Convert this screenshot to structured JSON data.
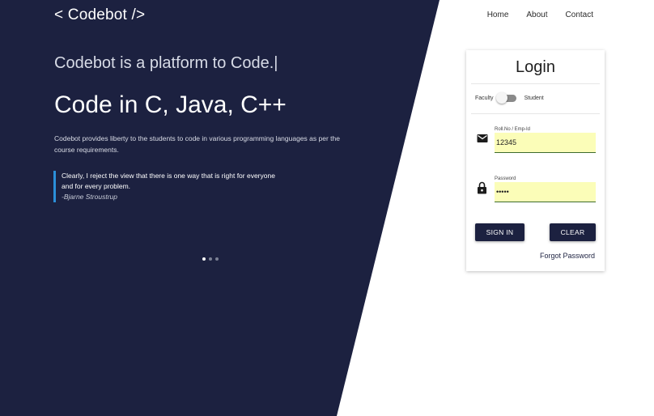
{
  "brand": "< Codebot />",
  "nav": {
    "home": "Home",
    "about": "About",
    "contact": "Contact"
  },
  "hero": {
    "typed_text": "Codebot is a platform to Code.|",
    "headline": "Code in C, Java, C++",
    "description": "Codebot provides liberty to the students to code in various programming languages as per the course requirements.",
    "quote_line1": "Clearly, I reject the view that there is one way that is right for everyone",
    "quote_line2": "and for every problem.",
    "quote_author": "-Bjarne Stroustrup"
  },
  "carousel": {
    "slides": 3,
    "active_index": 0
  },
  "login": {
    "title": "Login",
    "role_left": "Faculty",
    "role_right": "Student",
    "roll_label": "Roll.No / Emp-Id",
    "roll_value": "12345",
    "password_label": "Password",
    "password_value": "•••••",
    "sign_in_label": "SIGN IN",
    "clear_label": "CLEAR",
    "forgot_label": "Forgot Password"
  },
  "icons": {
    "email": "email-icon",
    "lock": "lock-icon"
  },
  "colors": {
    "navy": "#1c2140",
    "accent": "#2b8fd9",
    "field_bg": "#fbfdb8"
  }
}
